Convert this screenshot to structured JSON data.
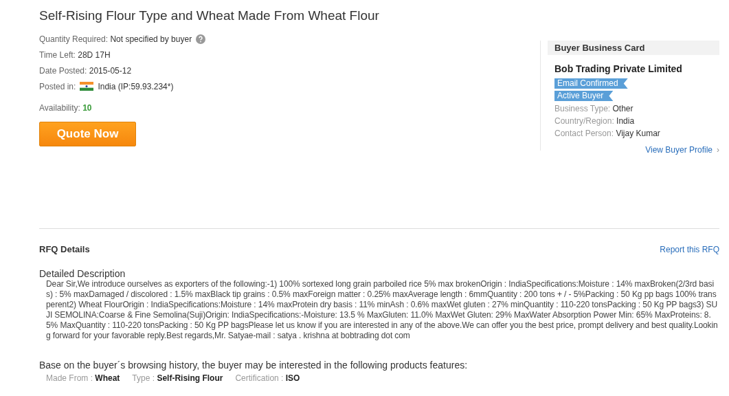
{
  "title": "Self-Rising Flour Type and Wheat Made From Wheat Flour",
  "info": [
    {
      "kind": "help",
      "label": "Quantity Required:",
      "value": "Not specified by buyer"
    },
    {
      "kind": "plain",
      "label": "Time Left:",
      "value": "28D 17H"
    },
    {
      "kind": "plain",
      "label": "Date Posted:",
      "value": "2015-05-12"
    },
    {
      "kind": "flag",
      "label": "Posted in:",
      "value": "India (IP:59.93.234*)"
    }
  ],
  "availability": {
    "label": "Availability:",
    "value": "10"
  },
  "quote_button": "Quote Now",
  "buyer_card": {
    "heading": "Buyer Business Card",
    "company": "Bob Trading Private Limited",
    "badges": [
      "Email Confirmed",
      "Active Buyer"
    ],
    "details": [
      {
        "label": "Business Type:",
        "value": "Other"
      },
      {
        "label": "Country/Region:",
        "value": "India"
      },
      {
        "label": "Contact Person:",
        "value": "Vijay Kumar"
      }
    ],
    "profile_link": "View Buyer Profile",
    "profile_arrow": "›"
  },
  "rfq": {
    "heading": "RFQ Details",
    "report_link": "Report this RFQ",
    "description_heading": "Detailed Description",
    "description": "Dear Sir,We introduce ourselves as exporters of the following:-1) 100% sortexed long grain parboiled rice 5% max brokenOrigin : IndiaSpecifications:Moisture : 14% maxBroken(2/3rd basis) : 5% maxDamaged / discolored : 1.5% maxBlack tip grains : 0.5% maxForeign matter : 0.25% maxAverage length : 6mmQuantity : 200 tons + / - 5%Packing : 50 Kg pp bags 100% transperent2) Wheat FlourOrigin : IndiaSpecifications:Moisture : 14% maxProtein dry basis : 11% minAsh : 0.6% maxWet gluten : 27% minQuantity : 110-220 tonsPacking : 50 Kg PP bags3) SUJI SEMOLINA:Coarse & Fine Semolina(Suji)Origin: IndiaSpecifications:-Moisture: 13.5 % MaxGluten: 11.0% MaxWet Gluten: 29% MaxWater Absorption Power Min: 65% MaxProteins: 8.5% MaxQuantity : 110-220 tonsPacking : 50 Kg PP bagsPlease let us know if you are interested in any of the above.We can offer you the best price, prompt delivery and best quality.Looking forward for your favorable reply.Best regards,Mr. Satyae-mail : satya . krishna at bobtrading dot com"
  },
  "features": {
    "intro": "Base on the buyer´s browsing history, the buyer may be interested in the following products features:",
    "items": [
      {
        "label": "Made From :",
        "value": "Wheat"
      },
      {
        "label": "Type :",
        "value": "Self-Rising Flour"
      },
      {
        "label": "Certification :",
        "value": "ISO"
      }
    ]
  }
}
